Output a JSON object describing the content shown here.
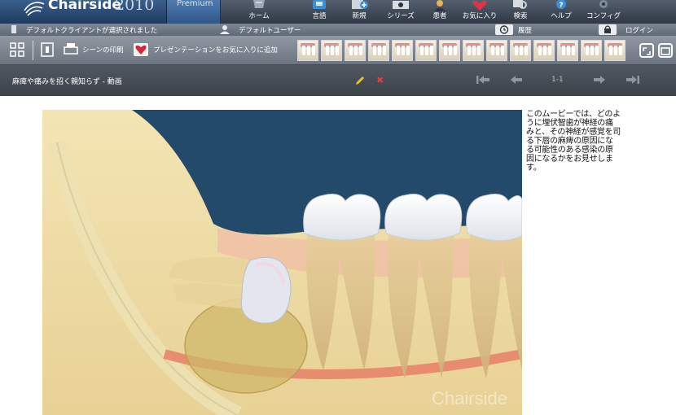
{
  "app": {
    "brand": "Chairside",
    "year": "2010",
    "edition": "Premium"
  },
  "nav": [
    {
      "label": "ホーム",
      "icon": "home-icon"
    },
    {
      "label": "言語",
      "icon": "language-icon"
    },
    {
      "label": "新規",
      "icon": "new-icon"
    },
    {
      "label": "シリーズ",
      "icon": "series-icon"
    },
    {
      "label": "患者",
      "icon": "patient-icon"
    },
    {
      "label": "お気に入り",
      "icon": "favorites-icon"
    },
    {
      "label": "検索",
      "icon": "search-icon"
    },
    {
      "label": "ヘルプ",
      "icon": "help-icon"
    },
    {
      "label": "コンフィグ",
      "icon": "config-icon"
    }
  ],
  "status": {
    "client": "デフォルトクライアントが選択されました",
    "user": "デフォルトユーザー",
    "history": "履歴",
    "login": "ログイン"
  },
  "toolbar": {
    "print_scene": "シーンの印刷",
    "add_to_favorites": "プレゼンテーションをお気に入りに追加"
  },
  "scene": {
    "title": "麻痺や痛みを招く親知らず - 動画",
    "page_indicator": "1-1",
    "description": "このムービーでは、どのように埋伏智歯が神経の痛みと、その神経が感覚を司る下唇の麻痺の原因になる可能性のある感染の原因になるかをお見せします。",
    "watermark": "Chairside"
  },
  "colors": {
    "header_dark": "#2f3844",
    "toolbar_gray": "#7d8794",
    "title_bar": "#454c55",
    "video_bg": "#244a6b",
    "delete_red": "#e43e3e",
    "pencil_yellow": "#f2c42b"
  }
}
